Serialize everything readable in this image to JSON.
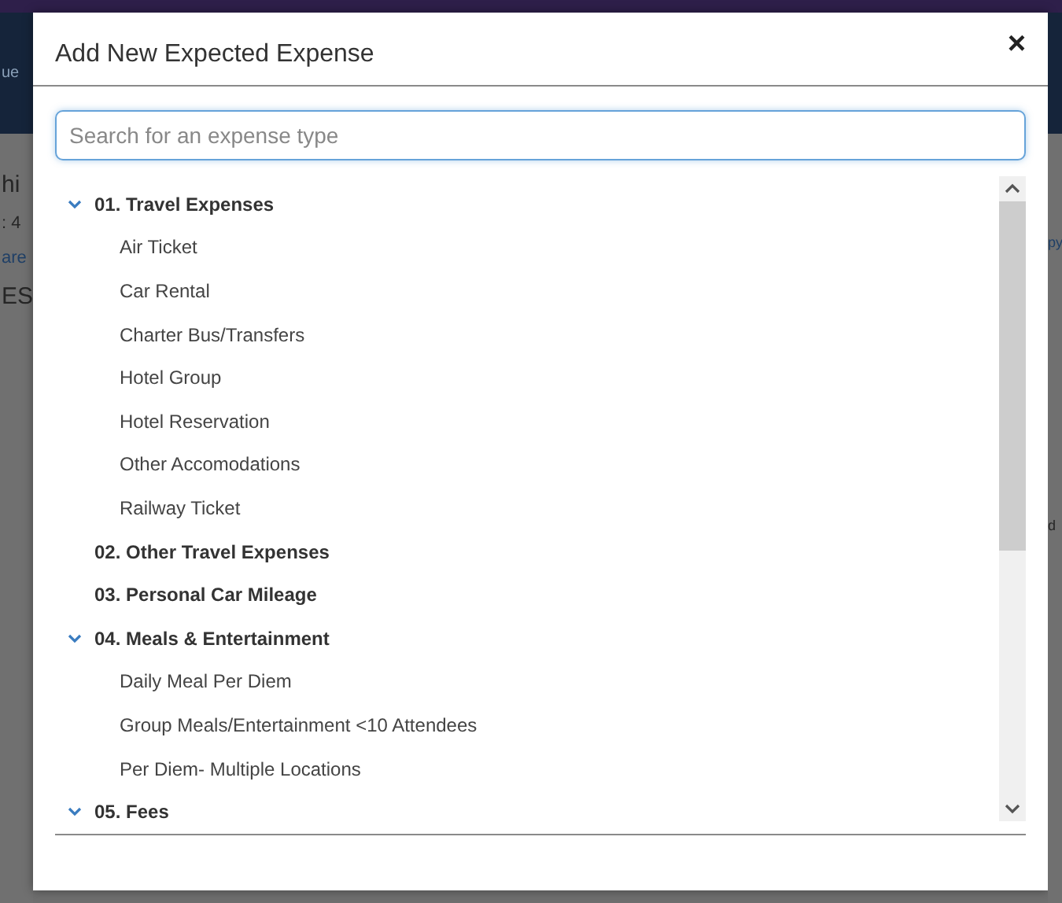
{
  "background": {
    "left_fragments": [
      {
        "kind": "header",
        "text": "ue"
      },
      {
        "kind": "large",
        "text": "hi"
      },
      {
        "kind": "plain",
        "text": ": 4"
      },
      {
        "kind": "link",
        "text": "are"
      },
      {
        "kind": "large",
        "text": "ES"
      }
    ],
    "right_fragments": [
      {
        "kind": "link",
        "text": "py"
      },
      {
        "kind": "plain",
        "text": "d"
      }
    ]
  },
  "dialog": {
    "title": "Add New Expected Expense",
    "close": "×",
    "search": {
      "placeholder": "Search for an expense type"
    },
    "groups": [
      {
        "label": "01. Travel Expenses",
        "expanded": true,
        "children": [
          "Air Ticket",
          "Car Rental",
          "Charter Bus/Transfers",
          "Hotel Group",
          "Hotel Reservation",
          "Other Accomodations",
          "Railway Ticket"
        ]
      },
      {
        "label": "02. Other Travel Expenses",
        "expanded": false
      },
      {
        "label": "03. Personal Car Mileage",
        "expanded": false
      },
      {
        "label": "04. Meals & Entertainment",
        "expanded": true,
        "children": [
          "Daily Meal Per Diem",
          "Group Meals/Entertainment <10 Attendees",
          "Per Diem- Multiple Locations"
        ]
      },
      {
        "label": "05. Fees",
        "expanded": true
      }
    ]
  }
}
